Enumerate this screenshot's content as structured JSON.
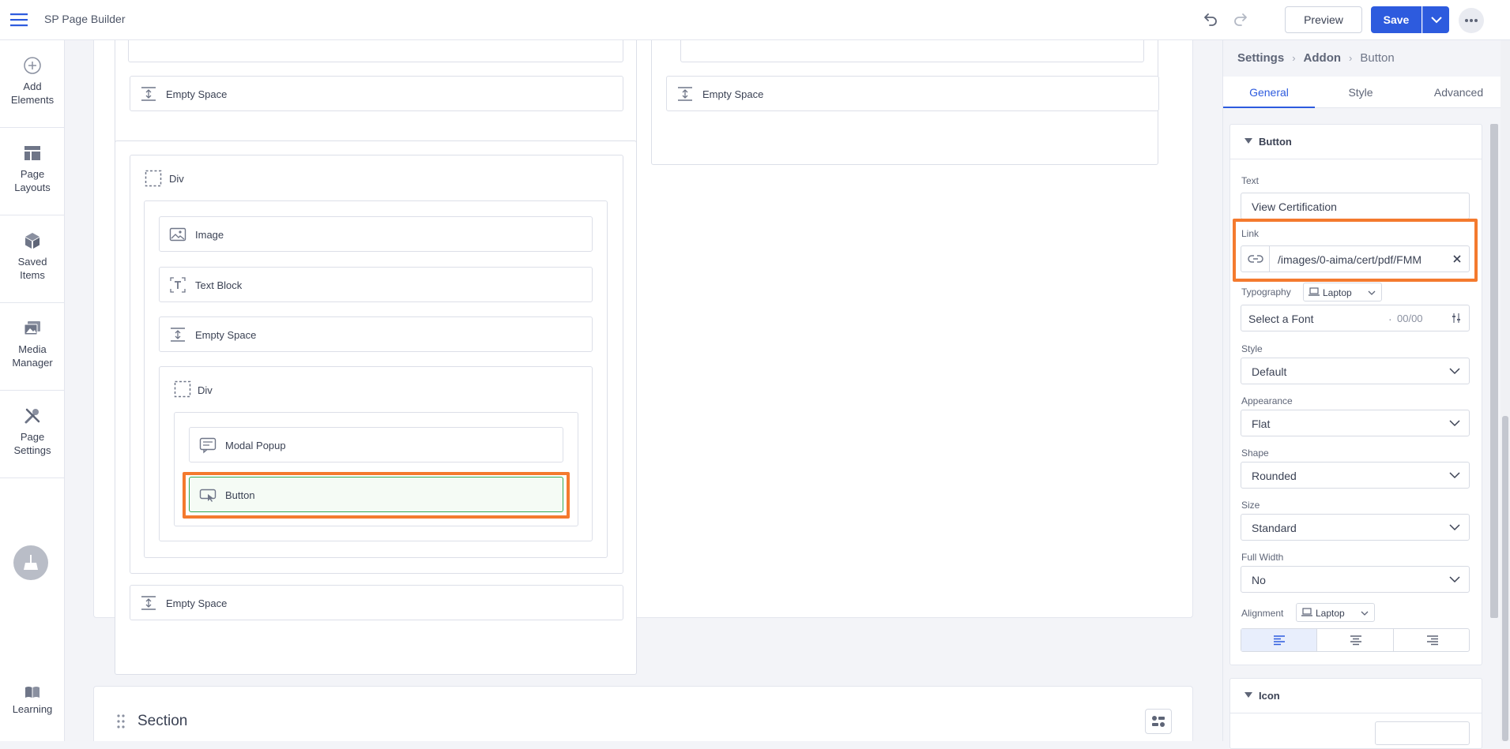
{
  "app": {
    "title": "SP Page Builder",
    "preview_label": "Preview",
    "save_label": "Save"
  },
  "sidebar": {
    "items": [
      {
        "label": "Add Elements",
        "icon": "plus-circle-icon"
      },
      {
        "label": "Page Layouts",
        "icon": "layout-icon"
      },
      {
        "label": "Saved Items",
        "icon": "box-icon"
      },
      {
        "label": "Media Manager",
        "icon": "images-icon"
      },
      {
        "label": "Page Settings",
        "icon": "tools-icon"
      }
    ],
    "learning_label": "Learning"
  },
  "canvas": {
    "top_left_empty_space": "Empty Space",
    "top_right_empty_space": "Empty Space",
    "div_outer_label": "Div",
    "image_label": "Image",
    "text_block_label": "Text Block",
    "empty_space_inner": "Empty Space",
    "div_inner_label": "Div",
    "modal_popup_label": "Modal Popup",
    "button_label": "Button",
    "bottom_empty_space": "Empty Space",
    "section_title": "Section"
  },
  "panel": {
    "breadcrumb": [
      "Settings",
      "Addon",
      "Button"
    ],
    "tabs": [
      "General",
      "Style",
      "Advanced"
    ],
    "active_tab": "General",
    "button_card": {
      "title": "Button",
      "text_label": "Text",
      "text_value": "View Certification",
      "link_label": "Link",
      "link_value": "/images/0-aima/cert/pdf/FMM",
      "typography_label": "Typography",
      "typography_device": "Laptop",
      "font_placeholder": "Select a Font",
      "font_size": "00/00",
      "style_label": "Style",
      "style_value": "Default",
      "appearance_label": "Appearance",
      "appearance_value": "Flat",
      "shape_label": "Shape",
      "shape_value": "Rounded",
      "size_label": "Size",
      "size_value": "Standard",
      "full_width_label": "Full Width",
      "full_width_value": "No",
      "alignment_label": "Alignment",
      "alignment_device": "Laptop",
      "alignment_selected": "left"
    },
    "icon_card": {
      "title": "Icon"
    }
  },
  "colors": {
    "accent": "#2d5bde",
    "highlight": "#f47a2e",
    "selected_addon_border": "#33a852"
  }
}
